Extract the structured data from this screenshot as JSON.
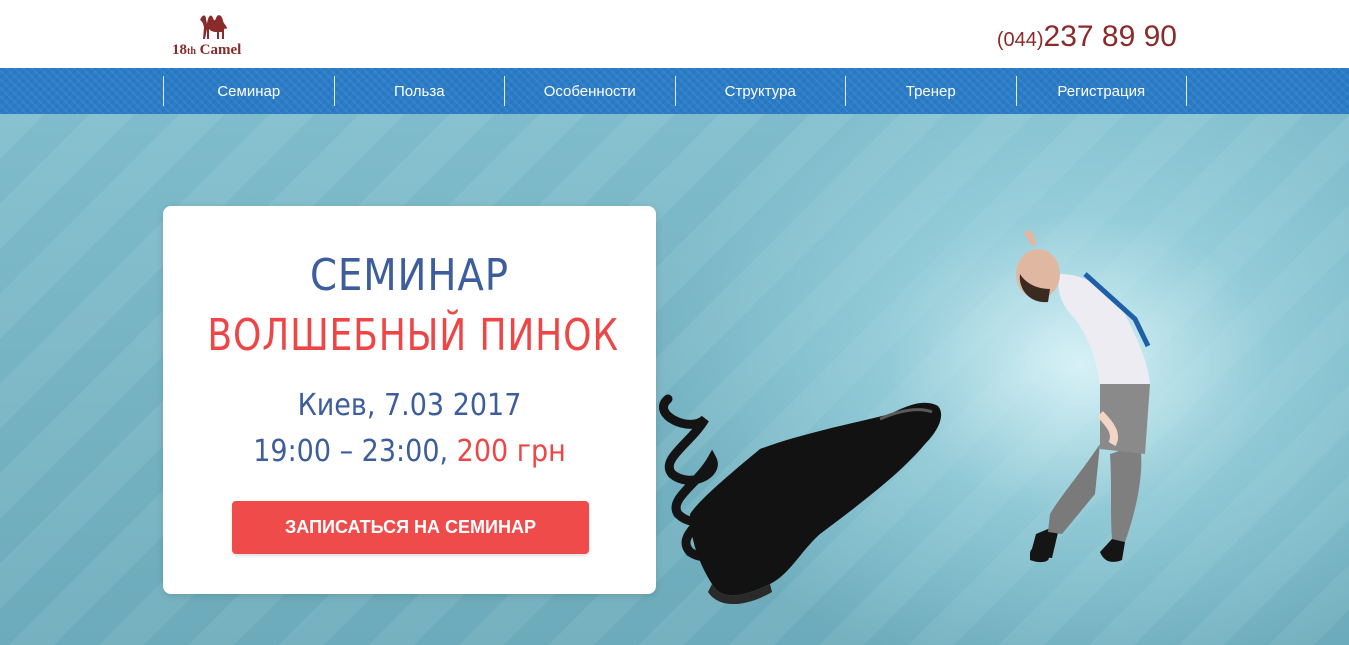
{
  "header": {
    "logo": {
      "prefix": "18",
      "suffix": "th",
      "name": " Camel"
    },
    "phone": {
      "code": "(044)",
      "number": "237 89 90"
    }
  },
  "nav": {
    "items": [
      {
        "label": "Семинар"
      },
      {
        "label": "Польза"
      },
      {
        "label": "Особенности"
      },
      {
        "label": "Структура"
      },
      {
        "label": "Тренер"
      },
      {
        "label": "Регистрация"
      }
    ]
  },
  "hero": {
    "title": "СЕМИНАР",
    "subtitle": "ВОЛШЕБНЫЙ ПИНОК",
    "city_date": "Киев, 7.03 2017",
    "time": "19:00 – 23:00,",
    "price": "200 грн",
    "cta_label": "ЗАПИСАТЬСЯ НА СЕМИНАР"
  },
  "colors": {
    "brand": "#8a2a2a",
    "nav": "#2a7cc8",
    "title_blue": "#3d5d9c",
    "accent_red": "#ee4646"
  }
}
